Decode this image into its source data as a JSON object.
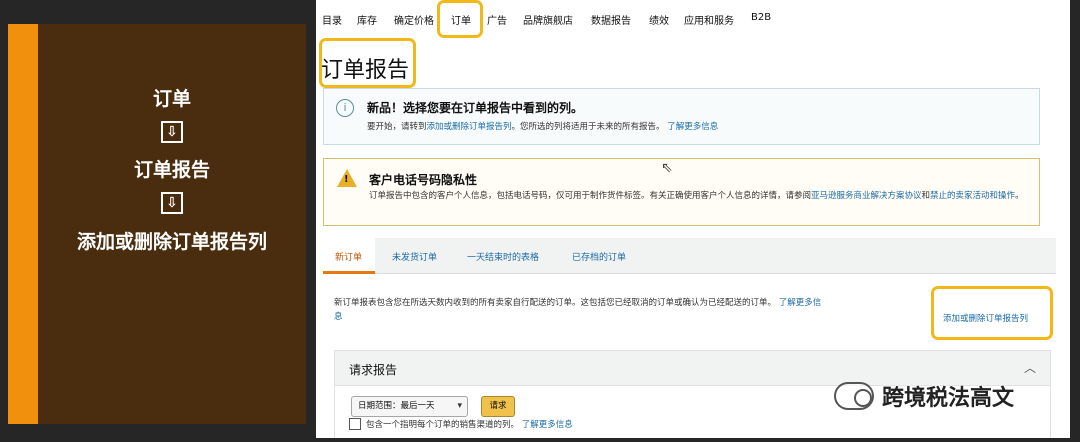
{
  "left_panel": {
    "steps": [
      "订单",
      "订单报告",
      "添加或删除订单报告列"
    ],
    "arrow_glyph": "⇩",
    "accent_color": "#f0900c",
    "background_color": "#4a2c0e"
  },
  "nav": {
    "items": [
      "目录",
      "库存",
      "确定价格",
      "订单",
      "广告",
      "品牌旗舰店",
      "数据报告",
      "绩效",
      "应用和服务",
      "B2B"
    ],
    "highlighted": "订单"
  },
  "page_title": "订单报告",
  "info_box": {
    "icon": "info-icon",
    "title": "新品！选择您要在订单报告中看到的列。",
    "text_prefix": "要开始，请转到",
    "text_link": "添加或删除订单报告列",
    "text_middle": "。您所选的列将适用于未来的所有报告。",
    "learn_more": "了解更多信息"
  },
  "warning_box": {
    "icon": "warning-icon",
    "title": "客户电话号码隐私性",
    "text_prefix": "订单报告中包含的客户个人信息，包括电话号码，仅可用于制作货件标签。有关正确使用客户个人信息的详情，请参阅",
    "link1": "亚马逊服务商业解决方案协议",
    "conj": "和",
    "link2": "禁止的卖家活动和操作",
    "suffix": "。"
  },
  "tabs": [
    "新订单",
    "未发货订单",
    "一天结束时的表格",
    "已存档的订单"
  ],
  "active_tab": "新订单",
  "description": {
    "text": "新订单报表包含您在所选天数内收到的所有卖家自行配送的订单。这包括您已经取消的订单或确认为已经配送的订单。",
    "learn_more": "了解更多信息"
  },
  "add_remove_link": "添加或删除订单报告列",
  "request_report": {
    "title": "请求报告",
    "date_range": "日期范围：最后一天",
    "button": "请求",
    "checkbox_label": "包含一个指明每个订单的销售渠道的列。",
    "learn_more": "了解更多信息"
  },
  "watermark": "跨境税法高文",
  "highlight_color": "#f2b81a"
}
